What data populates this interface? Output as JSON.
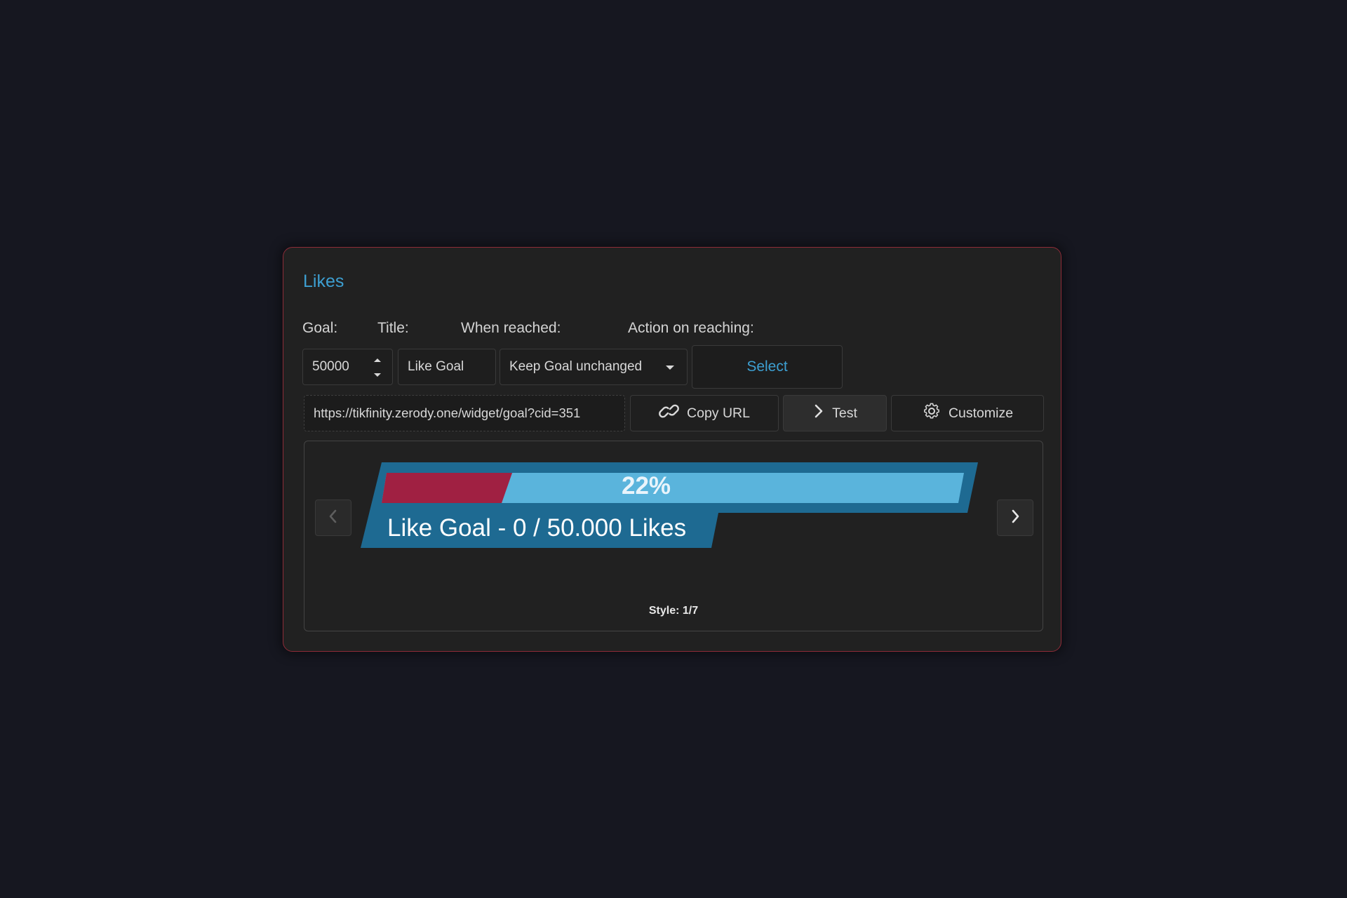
{
  "card": {
    "title": "Likes",
    "labels": {
      "goal": "Goal:",
      "title": "Title:",
      "when_reached": "When reached:",
      "action": "Action on reaching:"
    },
    "goal_value": "50000",
    "title_value": "Like Goal",
    "when_reached_value": "Keep Goal unchanged",
    "action_button": "Select",
    "url": "https://tikfinity.zerody.one/widget/goal?cid=351",
    "buttons": {
      "copy": "Copy URL",
      "test": "Test",
      "customize": "Customize"
    }
  },
  "preview": {
    "percent_label": "22%",
    "progress_fraction": 0.22,
    "goal_text": "Like Goal - 0 / 50.000 Likes",
    "style_label": "Style: 1/7",
    "colors": {
      "frame": "#1e6a92",
      "track": "#5ab4dc",
      "fill": "#a02042"
    }
  },
  "icons": {
    "copy": "link-icon",
    "test": "chevron-right-icon",
    "customize": "gear-icon",
    "prev": "chevron-left-icon",
    "next": "chevron-right-icon"
  }
}
